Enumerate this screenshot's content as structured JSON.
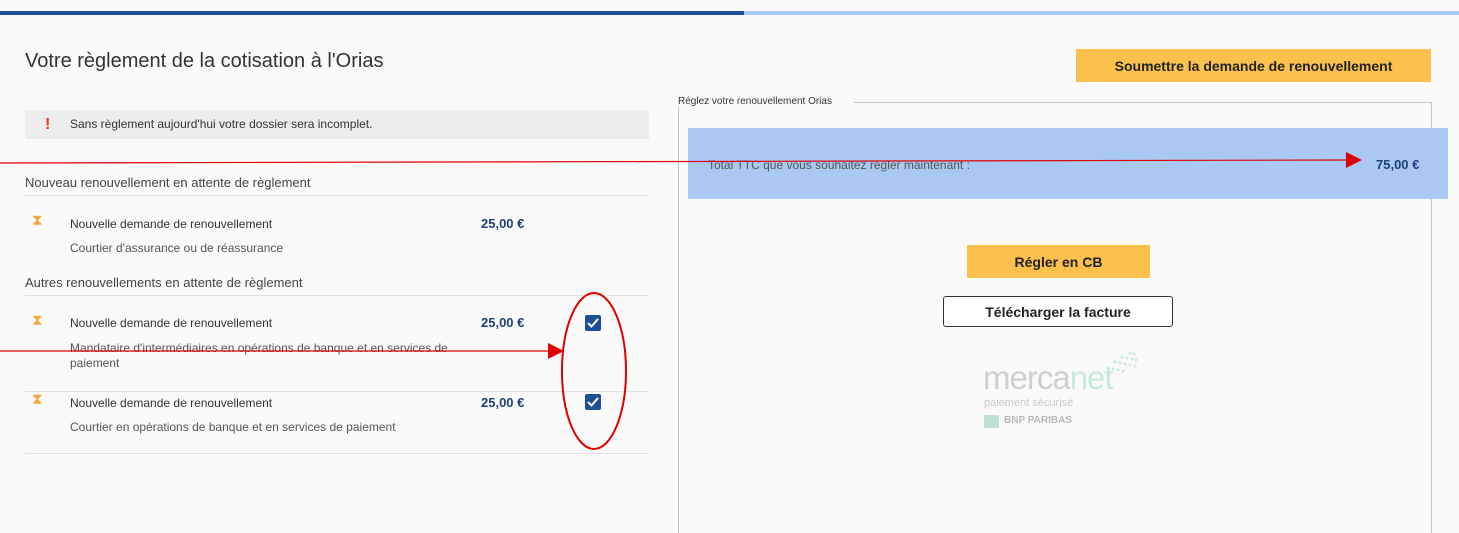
{
  "progress": {
    "fraction": 0.51,
    "fill_color": "#1e4f96",
    "track_color": "#a9c9f2"
  },
  "page_title": "Votre règlement de la cotisation à l'Orias",
  "submit_button": "Soumettre la demande de renouvellement",
  "alert": {
    "icon": "!",
    "text": "Sans règlement aujourd'hui votre dossier sera incomplet."
  },
  "new_section": {
    "title": "Nouveau renouvellement en attente de règlement",
    "items": [
      {
        "icon": "hourglass-icon",
        "title": "Nouvelle demande de renouvellement",
        "subtitle": "Courtier d'assurance ou de réassurance",
        "amount": "25,00 €"
      }
    ]
  },
  "other_section": {
    "title": "Autres renouvellements en attente de règlement",
    "items": [
      {
        "icon": "hourglass-icon",
        "title": "Nouvelle demande de renouvellement",
        "subtitle": "Mandataire d'intermédiaires en opérations de banque et en services de paiement",
        "amount": "25,00 €",
        "checked": true
      },
      {
        "icon": "hourglass-icon",
        "title": "Nouvelle demande de renouvellement",
        "subtitle": "Courtier en opérations de banque et en services de paiement",
        "amount": "25,00 €",
        "checked": true
      }
    ]
  },
  "payment": {
    "legend": "Réglez votre renouvellement Orias",
    "total_label": "Total TTC que vous souhaitez régler maintenant :",
    "total_amount": "75,00 €",
    "cb_button": "Régler en CB",
    "invoice_button": "Télécharger la facture"
  },
  "mercanet": {
    "word": "merca",
    "word_accent": "net",
    "tagline": "paiement sécurisé",
    "bank": "BNP PARIBAS"
  },
  "colors": {
    "accent_yellow": "#fcc14c",
    "amount_blue": "#1f3f7a",
    "total_bg": "#a9c9f2",
    "annotation_red": "#e00000"
  }
}
